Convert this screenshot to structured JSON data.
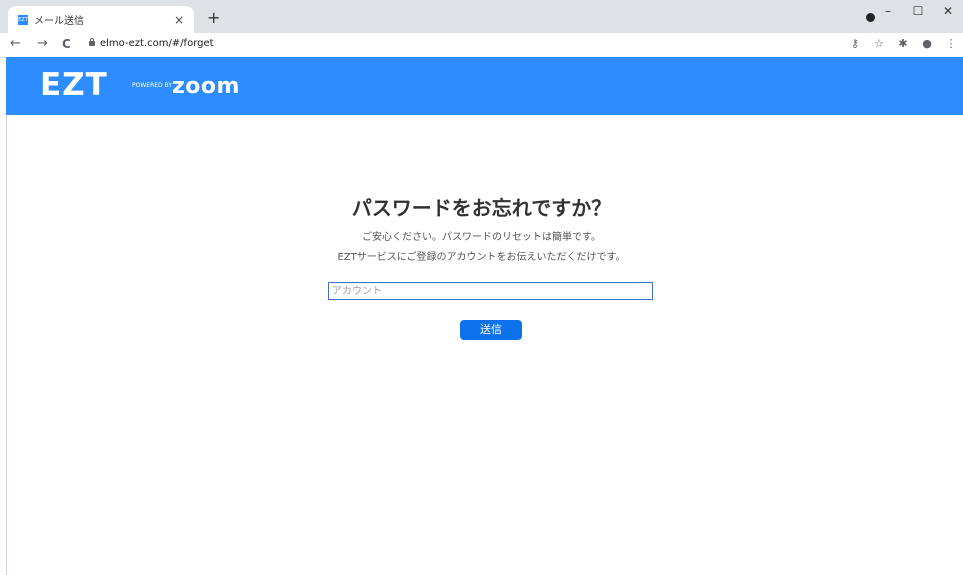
{
  "browser": {
    "tab": {
      "title": "メール送信",
      "favicon_text": "EZT",
      "close": "×"
    },
    "new_tab": "+",
    "window_controls": [
      "–",
      "☐",
      "✕"
    ],
    "nav": {
      "back": "←",
      "forward": "→",
      "reload": "C"
    },
    "url": "elmo-ezt.com/#/forget",
    "toolbar_icons": [
      "key-icon",
      "star-icon",
      "puzzle-icon",
      "profile-icon",
      "menu-icon"
    ]
  },
  "header": {
    "logo": "EZT",
    "powered_by": "POWERED BY",
    "brand": "zoom",
    "color": "#2d8cff"
  },
  "main": {
    "title": "パスワードをお忘れですか？",
    "subtitle_1": "ご安心ください。パスワードのリセットは簡単です。",
    "subtitle_2": "EZTサービスにご登録のアカウントをお伝えいただくだけです。",
    "account_input": {
      "placeholder": "アカウント",
      "value": ""
    },
    "send_button": "送信",
    "button_color": "#0e72ed"
  }
}
